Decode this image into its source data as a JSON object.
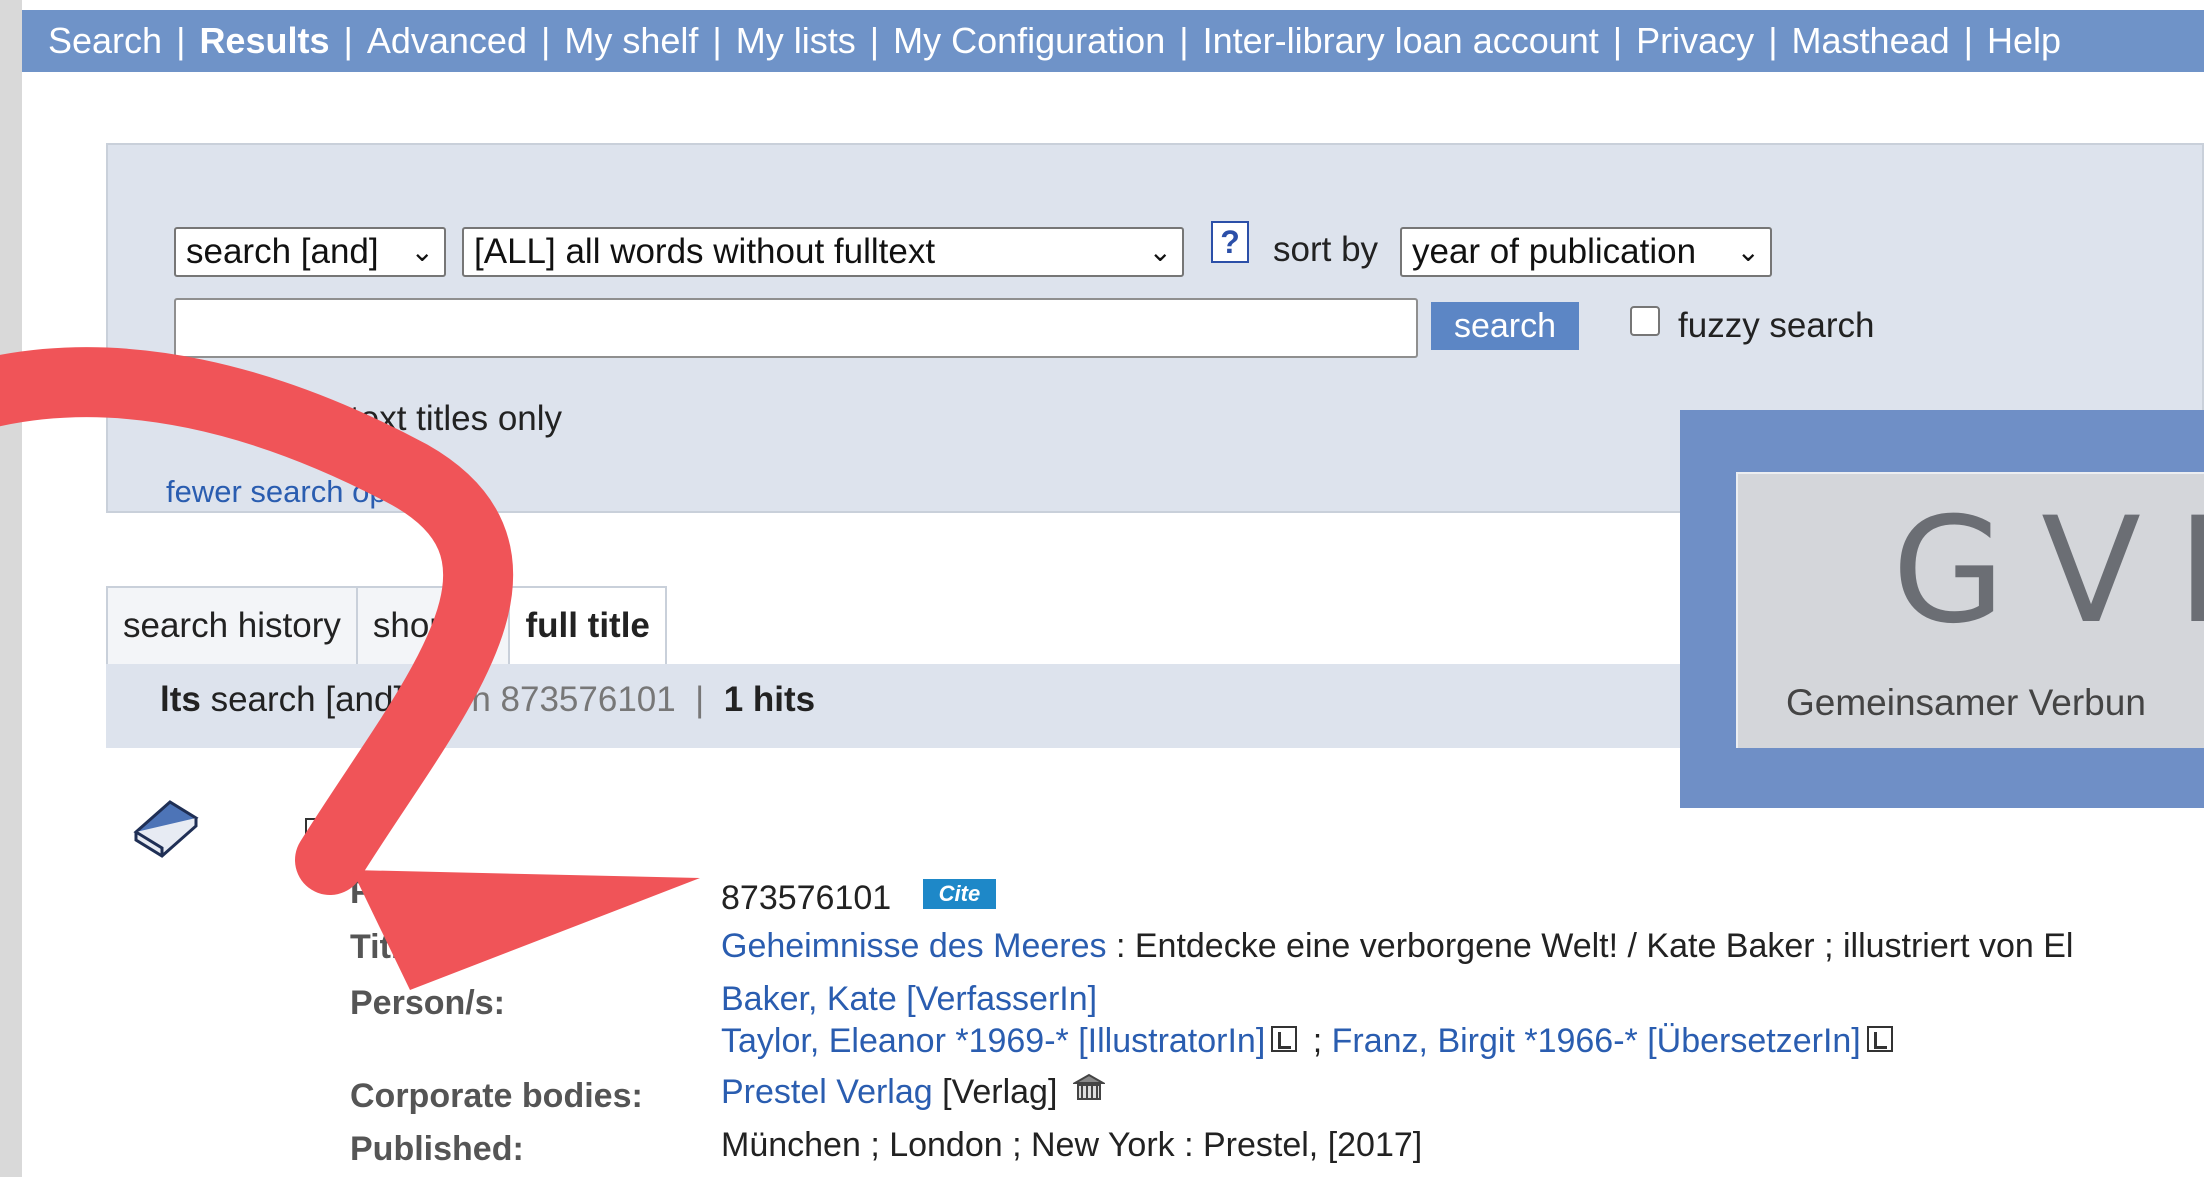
{
  "nav": {
    "items": [
      {
        "label": "Search",
        "active": false
      },
      {
        "label": "Results",
        "active": true
      },
      {
        "label": "Advanced",
        "active": false
      },
      {
        "label": "My shelf",
        "active": false
      },
      {
        "label": "My lists",
        "active": false
      },
      {
        "label": "My Configuration",
        "active": false
      },
      {
        "label": "Inter-library loan account",
        "active": false
      },
      {
        "label": "Privacy",
        "active": false
      },
      {
        "label": "Masthead",
        "active": false
      },
      {
        "label": "Help",
        "active": false
      }
    ],
    "separator": "|"
  },
  "search": {
    "operator_select": "search [and]",
    "field_select": "[ALL] all words without fulltext",
    "help_glyph": "?",
    "sort_label": "sort by",
    "sort_select": "year of publication",
    "input_value": "",
    "search_button": "search",
    "fuzzy_label": "fuzzy search",
    "fulltext_label": "text titles only",
    "fewer_options_link": "fewer search options"
  },
  "logo": {
    "letters": "GVK",
    "subtitle": "Gemeinsamer Verbun"
  },
  "tabs": [
    {
      "label": "search history",
      "active": false
    },
    {
      "label": "shortlist",
      "active": false
    },
    {
      "label": "full title",
      "active": true
    }
  ],
  "results_bar": {
    "label": "lts",
    "mode": "search [and]",
    "query": "ppn 873576101",
    "divider": "|",
    "hits": "1 hits"
  },
  "record": {
    "ppn_label": "PPN:",
    "ppn_value": "873576101",
    "cite_label": "Cite",
    "title_label": "Title",
    "title_link": "Geheimnisse des Meeres",
    "title_rest": " : Entdecke eine verborgene Welt! / Kate Baker ; illustriert von El",
    "persons_label": "Person/s:",
    "person_1": "Baker, Kate [VerfasserIn]",
    "person_2": "Taylor, Eleanor *1969-* [IllustratorIn]",
    "person_sep": " ; ",
    "person_3": "Franz, Birgit *1966-* [ÜbersetzerIn]",
    "corporate_label": "Corporate bodies:",
    "corporate_link": "Prestel Verlag",
    "corporate_role": " [Verlag]",
    "published_label": "Published:",
    "published_value": "München ; London ; New York : Prestel, [2017]"
  },
  "colors": {
    "nav_bg": "#6f93c8",
    "panel_bg": "#dde3ed",
    "link": "#2a5db0",
    "arrow": "#f05458"
  }
}
